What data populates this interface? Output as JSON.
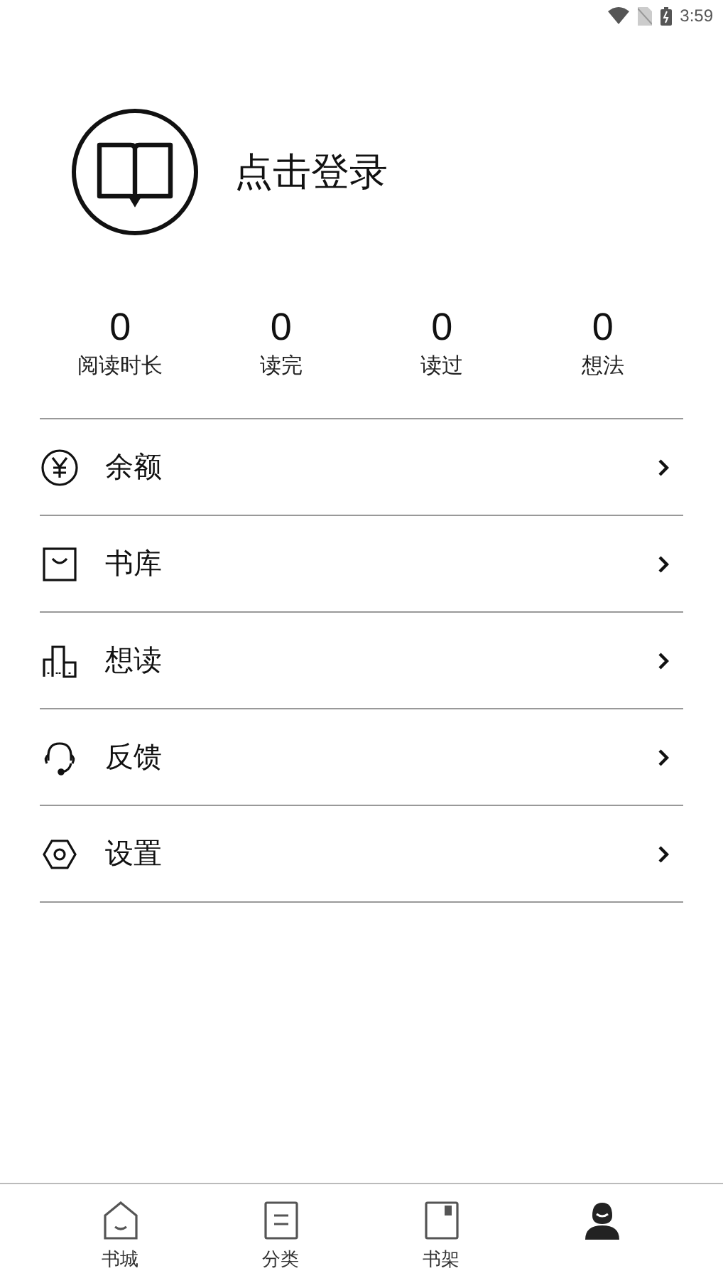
{
  "status_bar": {
    "time": "3:59"
  },
  "profile": {
    "login_label": "点击登录"
  },
  "stats": [
    {
      "value": "0",
      "label": "阅读时长"
    },
    {
      "value": "0",
      "label": "读完"
    },
    {
      "value": "0",
      "label": "读过"
    },
    {
      "value": "0",
      "label": "想法"
    }
  ],
  "menu": [
    {
      "kind": "yuan",
      "label": "余额"
    },
    {
      "kind": "library",
      "label": "书库"
    },
    {
      "kind": "chart",
      "label": "想读"
    },
    {
      "kind": "headset",
      "label": "反馈"
    },
    {
      "kind": "settings",
      "label": "设置"
    }
  ],
  "bottom_nav": [
    {
      "kind": "store",
      "label": "书城",
      "selected": false
    },
    {
      "kind": "category",
      "label": "分类",
      "selected": false
    },
    {
      "kind": "shelf",
      "label": "书架",
      "selected": false
    },
    {
      "kind": "profile",
      "selected": true
    }
  ]
}
